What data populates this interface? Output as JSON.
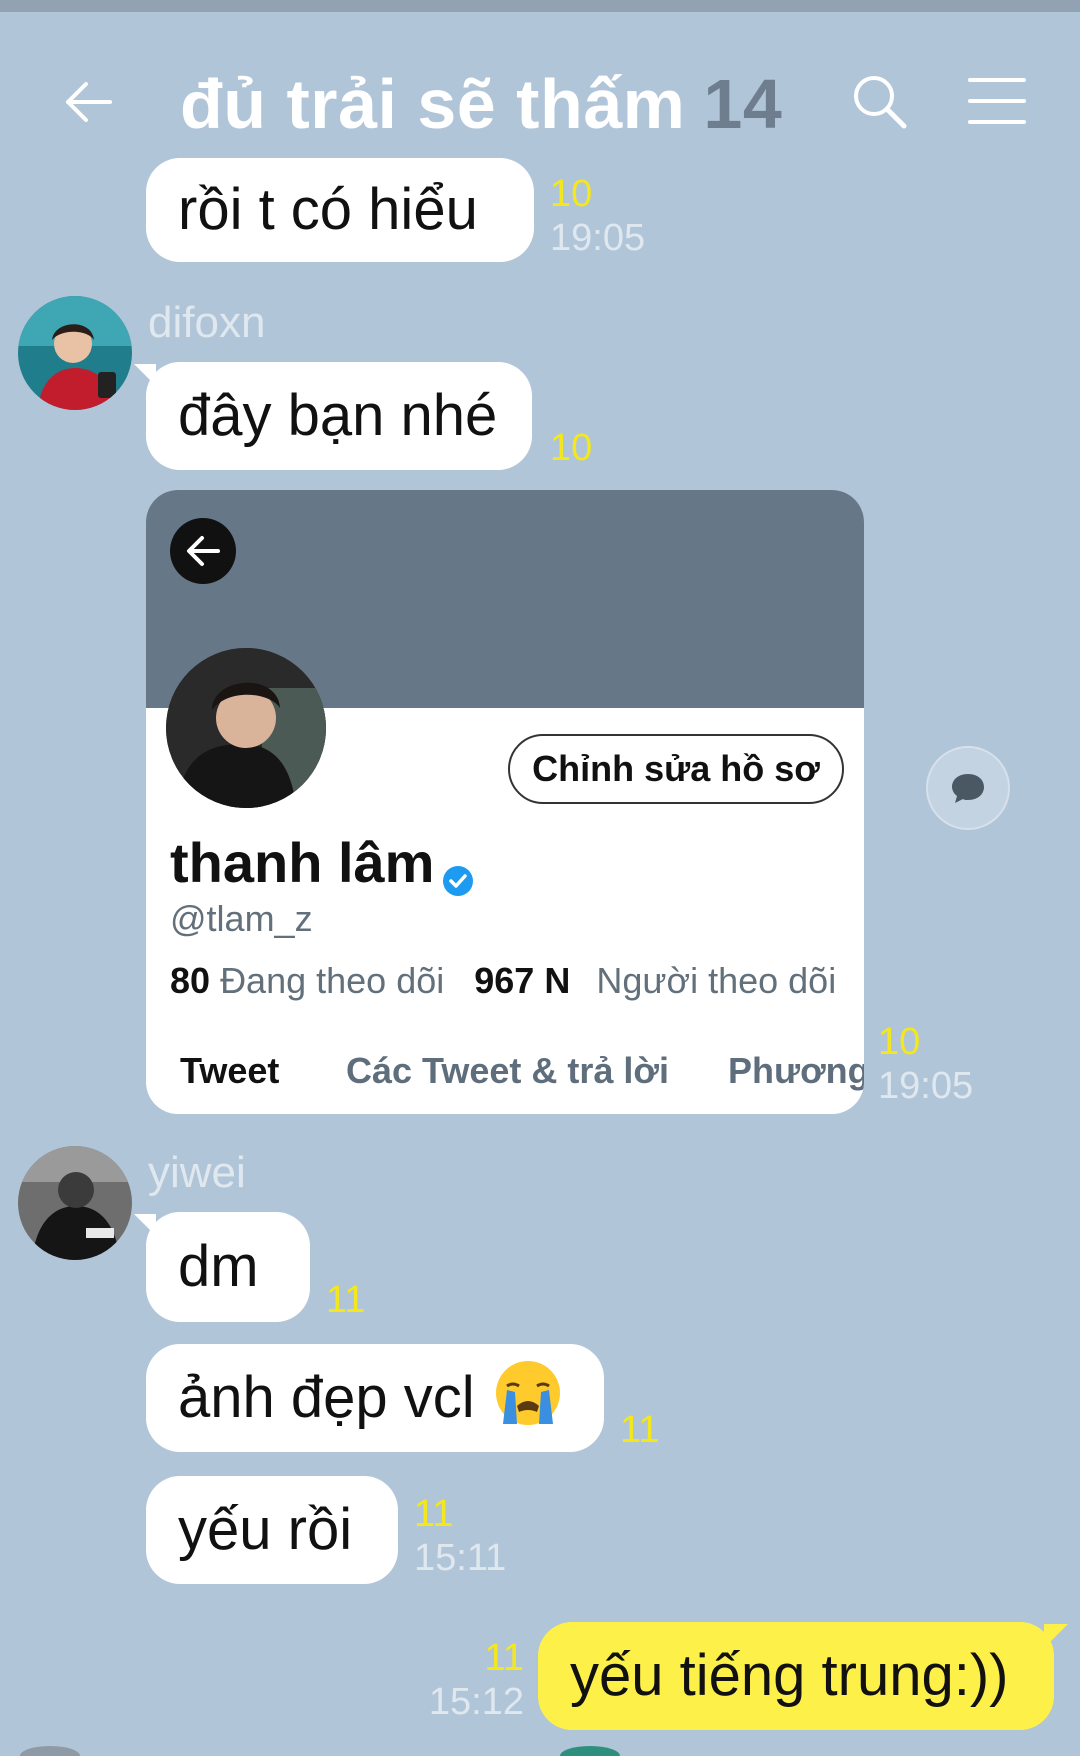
{
  "header": {
    "title": "đủ trải sẽ thấm",
    "member_count": "14"
  },
  "messages": {
    "m1": {
      "text": "rồi t có hiểu",
      "count": "10",
      "time": "19:05"
    },
    "m2": {
      "sender": "difoxn",
      "text": "đây bạn nhé",
      "count": "10"
    },
    "card": {
      "edit_profile": "Chỉnh sửa hồ sơ",
      "name": "thanh lâm",
      "handle": "@tlam_z",
      "following_count": "80",
      "following_label": "Đang theo dõi",
      "followers_count": "967 N",
      "followers_label": "Người theo dõi",
      "tabs": [
        "Tweet",
        "Các Tweet & trả lời",
        "Phương"
      ],
      "count": "10",
      "time": "19:05"
    },
    "m3": {
      "sender": "yiwei",
      "text": "dm",
      "count": "11"
    },
    "m4": {
      "text": "ảnh đẹp vcl",
      "emoji": "😭",
      "count": "11"
    },
    "m5": {
      "text": "yếu rồi",
      "count": "11",
      "time": "15:11"
    },
    "m6": {
      "text": "yếu tiếng trung:))",
      "count": "11",
      "time": "15:12"
    }
  },
  "colors": {
    "background": "#b1c5d9",
    "my_bubble": "#fdf049",
    "unread_count": "#f4e81c"
  }
}
